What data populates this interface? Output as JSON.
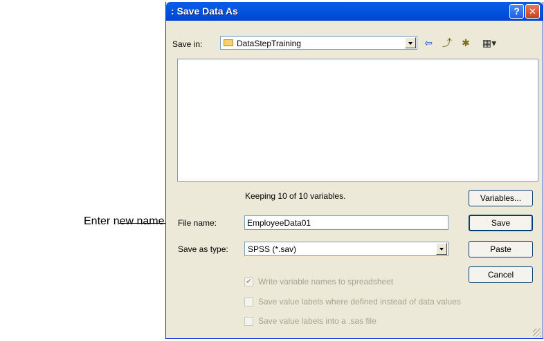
{
  "callout": {
    "text": "Enter new name"
  },
  "window": {
    "title": ": Save Data As",
    "help_symbol": "?",
    "close_symbol": "✕"
  },
  "save_in": {
    "label": "Save in:",
    "value": "DataStepTraining"
  },
  "toolbar": {
    "back_symbol": "⇦",
    "up_symbol": "⤴",
    "new_folder_symbol": "✱",
    "views_symbol": "▦▾"
  },
  "status": {
    "text": "Keeping 10 of 10 variables."
  },
  "file_name": {
    "label": "File name:",
    "value": "EmployeeData01"
  },
  "save_as_type": {
    "label": "Save as type:",
    "value": "SPSS (*.sav)"
  },
  "buttons": {
    "variables": "Variables...",
    "save": "Save",
    "paste": "Paste",
    "cancel": "Cancel"
  },
  "options": [
    {
      "label": "Write variable names to spreadsheet",
      "checked": true,
      "enabled": false
    },
    {
      "label": "Save value labels where defined instead of data values",
      "checked": false,
      "enabled": false
    },
    {
      "label": "Save value labels into a .sas file",
      "checked": false,
      "enabled": false
    }
  ],
  "colors": {
    "titlebar": "#0054e3",
    "dialog_bg": "#ece9d8",
    "close_button": "#c8411d",
    "disabled_text": "#a6a391"
  }
}
